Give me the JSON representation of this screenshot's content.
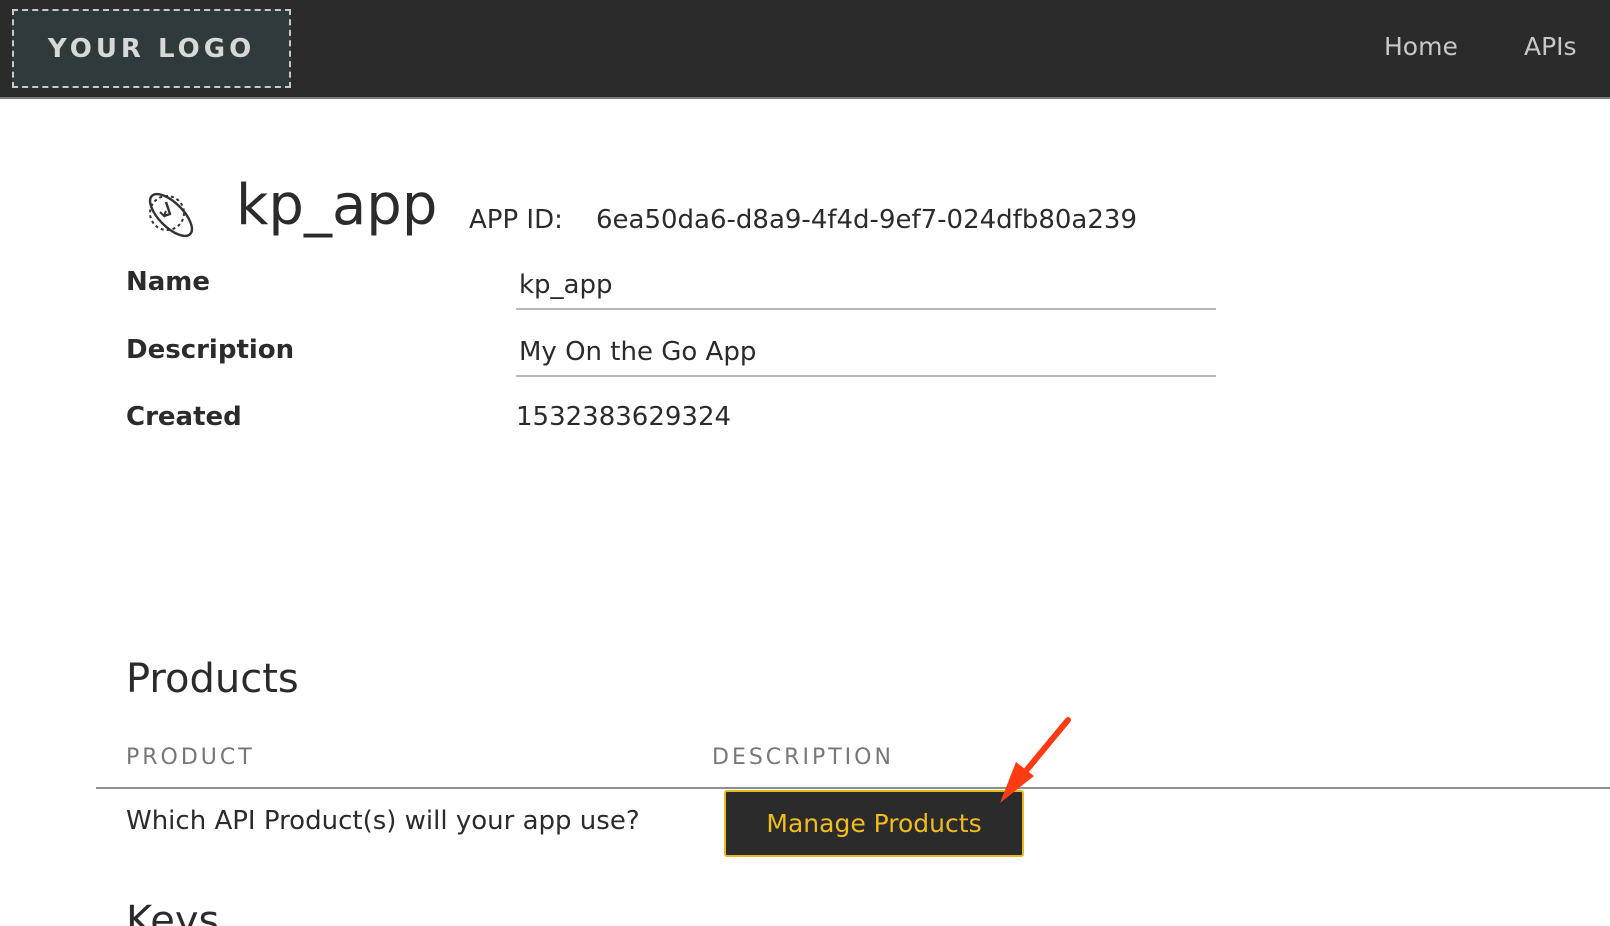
{
  "header": {
    "logo_text": "YOUR LOGO",
    "nav": [
      "Home",
      "APIs"
    ]
  },
  "app": {
    "title": "kp_app",
    "app_id_label": "APP ID:",
    "app_id_value": "6ea50da6-d8a9-4f4d-9ef7-024dfb80a239",
    "icon": "satellite-orbit-icon"
  },
  "fields": {
    "name_label": "Name",
    "name_value": "kp_app",
    "description_label": "Description",
    "description_value": "My On the Go App",
    "created_label": "Created",
    "created_value": "1532383629324"
  },
  "products": {
    "section_title": "Products",
    "columns": [
      "PRODUCT",
      "DESCRIPTION"
    ],
    "prompt": "Which API Product(s) will your app use?",
    "manage_button": "Manage Products"
  },
  "keys": {
    "section_title": "Keys"
  },
  "colors": {
    "topbar": "#2b2b2b",
    "button_text": "#f2bb1e",
    "button_border": "#e8b81c",
    "arrow": "#ff3b14"
  }
}
